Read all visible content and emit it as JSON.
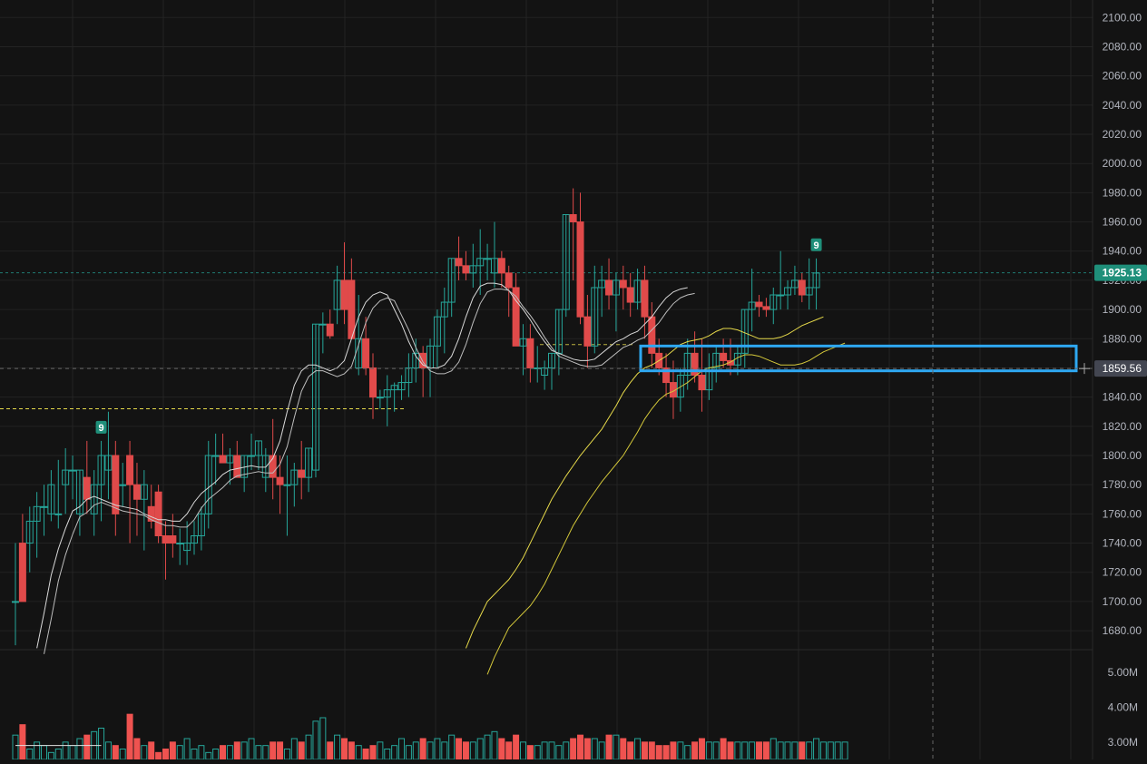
{
  "colors": {
    "background": "#131313",
    "grid": "#232323",
    "up": "#26a69a",
    "down": "#ef5350",
    "down_candle": "#e04a4a",
    "ma_fast": "#d9d9d9",
    "ma_slow": "#e6d94a",
    "highlight_box": "#2ea8f2",
    "current_price_bg": "#1f8f7a",
    "crosshair_price_bg": "#434651",
    "axis_text": "#b2b5be"
  },
  "price_axis": {
    "ticks": [
      "2100.00",
      "2080.00",
      "2060.00",
      "2040.00",
      "2020.00",
      "2000.00",
      "1980.00",
      "1960.00",
      "1940.00",
      "1920.00",
      "1900.00",
      "1880.00",
      "1860.00",
      "1840.00",
      "1820.00",
      "1800.00",
      "1780.00",
      "1760.00",
      "1740.00",
      "1720.00",
      "1700.00",
      "1680.00"
    ],
    "current_price_label": "1925.13",
    "crosshair_price_label": "1859.56"
  },
  "volume_axis": {
    "ticks": [
      "5.00M",
      "4.00M",
      "3.00M"
    ]
  },
  "markers": [
    {
      "label": "9",
      "candle_index": 12,
      "color": "up"
    },
    {
      "label": "9",
      "candle_index": 112,
      "color": "up"
    }
  ],
  "chart_data": {
    "type": "candlestick",
    "title": "",
    "ylim": [
      1667,
      2112
    ],
    "grid": true,
    "current_price": 1925.13,
    "crosshair_price": 1859.56,
    "support_level": 1832,
    "support_level_2": 1876,
    "highlight_zone": {
      "top": 1875,
      "bottom": 1858
    },
    "candles": [
      [
        1700,
        1740,
        1670,
        1700
      ],
      [
        1740,
        1760,
        1700,
        1700
      ],
      [
        1740,
        1765,
        1720,
        1755
      ],
      [
        1755,
        1775,
        1730,
        1765
      ],
      [
        1765,
        1780,
        1745,
        1765
      ],
      [
        1760,
        1790,
        1755,
        1780
      ],
      [
        1760,
        1797,
        1750,
        1760
      ],
      [
        1780,
        1805,
        1760,
        1790
      ],
      [
        1790,
        1800,
        1770,
        1790
      ],
      [
        1760,
        1790,
        1745,
        1790
      ],
      [
        1785,
        1810,
        1760,
        1770
      ],
      [
        1760,
        1790,
        1745,
        1780
      ],
      [
        1780,
        1810,
        1755,
        1800
      ],
      [
        1790,
        1830,
        1770,
        1800
      ],
      [
        1800,
        1810,
        1745,
        1760
      ],
      [
        1780,
        1795,
        1765,
        1780
      ],
      [
        1800,
        1810,
        1740,
        1780
      ],
      [
        1780,
        1795,
        1745,
        1770
      ],
      [
        1770,
        1790,
        1735,
        1780
      ],
      [
        1765,
        1780,
        1750,
        1755
      ],
      [
        1775,
        1780,
        1740,
        1745
      ],
      [
        1745,
        1755,
        1715,
        1740
      ],
      [
        1745,
        1760,
        1730,
        1740
      ],
      [
        1740,
        1750,
        1725,
        1740
      ],
      [
        1735,
        1755,
        1725,
        1740
      ],
      [
        1740,
        1755,
        1732,
        1745
      ],
      [
        1745,
        1765,
        1735,
        1760
      ],
      [
        1760,
        1810,
        1750,
        1800
      ],
      [
        1800,
        1815,
        1780,
        1800
      ],
      [
        1800,
        1815,
        1795,
        1795
      ],
      [
        1795,
        1805,
        1780,
        1800
      ],
      [
        1800,
        1810,
        1785,
        1785
      ],
      [
        1785,
        1800,
        1775,
        1800
      ],
      [
        1800,
        1815,
        1790,
        1800
      ],
      [
        1800,
        1810,
        1790,
        1810
      ],
      [
        1785,
        1805,
        1775,
        1800
      ],
      [
        1800,
        1825,
        1770,
        1785
      ],
      [
        1785,
        1800,
        1760,
        1780
      ],
      [
        1780,
        1800,
        1745,
        1780
      ],
      [
        1780,
        1795,
        1765,
        1790
      ],
      [
        1790,
        1810,
        1770,
        1785
      ],
      [
        1785,
        1805,
        1775,
        1805
      ],
      [
        1790,
        1890,
        1785,
        1890
      ],
      [
        1890,
        1898,
        1870,
        1890
      ],
      [
        1890,
        1900,
        1880,
        1882
      ],
      [
        1900,
        1930,
        1890,
        1920
      ],
      [
        1920,
        1946,
        1890,
        1900
      ],
      [
        1920,
        1935,
        1900,
        1880
      ],
      [
        1860,
        1910,
        1855,
        1880
      ],
      [
        1880,
        1895,
        1855,
        1860
      ],
      [
        1860,
        1870,
        1825,
        1840
      ],
      [
        1840,
        1845,
        1832,
        1840
      ],
      [
        1840,
        1855,
        1820,
        1845
      ],
      [
        1845,
        1850,
        1830,
        1848
      ],
      [
        1845,
        1855,
        1838,
        1850
      ],
      [
        1850,
        1870,
        1840,
        1860
      ],
      [
        1860,
        1880,
        1850,
        1870
      ],
      [
        1870,
        1875,
        1840,
        1860
      ],
      [
        1860,
        1880,
        1840,
        1875
      ],
      [
        1875,
        1900,
        1860,
        1895
      ],
      [
        1895,
        1915,
        1870,
        1905
      ],
      [
        1905,
        1935,
        1895,
        1935
      ],
      [
        1935,
        1950,
        1920,
        1930
      ],
      [
        1930,
        1940,
        1920,
        1925
      ],
      [
        1925,
        1945,
        1915,
        1930
      ],
      [
        1930,
        1955,
        1910,
        1935
      ],
      [
        1935,
        1945,
        1920,
        1935
      ],
      [
        1925,
        1960,
        1915,
        1935
      ],
      [
        1935,
        1940,
        1915,
        1925
      ],
      [
        1925,
        1930,
        1895,
        1915
      ],
      [
        1915,
        1925,
        1875,
        1875
      ],
      [
        1875,
        1890,
        1855,
        1880
      ],
      [
        1880,
        1890,
        1850,
        1860
      ],
      [
        1860,
        1875,
        1850,
        1860
      ],
      [
        1855,
        1865,
        1845,
        1860
      ],
      [
        1860,
        1870,
        1845,
        1870
      ],
      [
        1870,
        1900,
        1855,
        1900
      ],
      [
        1900,
        1965,
        1895,
        1965
      ],
      [
        1965,
        1983,
        1920,
        1960
      ],
      [
        1960,
        1980,
        1890,
        1895
      ],
      [
        1895,
        1910,
        1860,
        1875
      ],
      [
        1875,
        1930,
        1870,
        1915
      ],
      [
        1915,
        1930,
        1895,
        1920
      ],
      [
        1920,
        1935,
        1900,
        1910
      ],
      [
        1910,
        1925,
        1885,
        1920
      ],
      [
        1920,
        1930,
        1900,
        1915
      ],
      [
        1915,
        1925,
        1895,
        1905
      ],
      [
        1905,
        1928,
        1900,
        1920
      ],
      [
        1920,
        1930,
        1880,
        1895
      ],
      [
        1895,
        1905,
        1860,
        1870
      ],
      [
        1870,
        1880,
        1855,
        1860
      ],
      [
        1860,
        1870,
        1840,
        1850
      ],
      [
        1850,
        1865,
        1825,
        1840
      ],
      [
        1840,
        1860,
        1830,
        1855
      ],
      [
        1855,
        1880,
        1845,
        1870
      ],
      [
        1870,
        1885,
        1850,
        1855
      ],
      [
        1855,
        1880,
        1830,
        1845
      ],
      [
        1845,
        1870,
        1838,
        1860
      ],
      [
        1860,
        1875,
        1850,
        1870
      ],
      [
        1870,
        1880,
        1860,
        1865
      ],
      [
        1865,
        1880,
        1855,
        1862
      ],
      [
        1862,
        1875,
        1855,
        1870
      ],
      [
        1870,
        1900,
        1860,
        1900
      ],
      [
        1900,
        1928,
        1885,
        1905
      ],
      [
        1905,
        1910,
        1895,
        1902
      ],
      [
        1902,
        1908,
        1895,
        1900
      ],
      [
        1900,
        1915,
        1890,
        1910
      ],
      [
        1910,
        1940,
        1900,
        1910
      ],
      [
        1910,
        1920,
        1900,
        1915
      ],
      [
        1915,
        1930,
        1910,
        1920
      ],
      [
        1920,
        1925,
        1905,
        1910
      ],
      [
        1910,
        1935,
        1900,
        1915
      ],
      [
        1915,
        1935,
        1900,
        1925
      ]
    ],
    "ma_fast_1": [
      1668,
      1692,
      1718,
      1736,
      1750,
      1762,
      1765,
      1770,
      1772,
      1770,
      1768,
      1766,
      1765,
      1764,
      1763,
      1760,
      1758,
      1756,
      1756,
      1755,
      1755,
      1760,
      1768,
      1774,
      1778,
      1782,
      1787,
      1790,
      1791,
      1792,
      1793,
      1792,
      1792,
      1798,
      1810,
      1830,
      1848,
      1858,
      1862,
      1862,
      1860,
      1858,
      1860,
      1865,
      1880,
      1895,
      1905,
      1910,
      1912,
      1910,
      1900,
      1890,
      1878,
      1868,
      1862,
      1860,
      1860,
      1862,
      1868,
      1880,
      1895,
      1908,
      1916,
      1918,
      1918,
      1917,
      1913,
      1906,
      1900,
      1893,
      1885,
      1878,
      1872,
      1870,
      1868,
      1866,
      1865,
      1865,
      1866,
      1870,
      1874,
      1878,
      1880,
      1883,
      1885,
      1890,
      1895,
      1902,
      1908,
      1912,
      1914,
      1915
    ],
    "ma_slow_1": [
      1668,
      1680,
      1690,
      1700,
      1705,
      1710,
      1715,
      1722,
      1730,
      1740,
      1750,
      1760,
      1770,
      1778,
      1786,
      1793,
      1800,
      1806,
      1812,
      1818,
      1826,
      1834,
      1843,
      1850,
      1856,
      1860,
      1862,
      1865,
      1868,
      1872,
      1876,
      1878,
      1879,
      1880,
      1882,
      1885,
      1887,
      1887,
      1886,
      1884,
      1882,
      1880,
      1880,
      1880,
      1881,
      1883,
      1886,
      1889,
      1891,
      1893,
      1895
    ]
  },
  "volume": {
    "ylim": [
      2.5,
      5.5
    ],
    "bars": [
      3.2,
      3.5,
      2.8,
      3.0,
      2.9,
      2.7,
      2.8,
      3.0,
      2.9,
      3.1,
      3.2,
      3.3,
      3.4,
      3.0,
      2.9,
      2.8,
      3.8,
      3.1,
      2.9,
      3.0,
      2.7,
      2.8,
      3.0,
      2.9,
      3.1,
      2.8,
      2.9,
      2.7,
      2.8,
      2.9,
      2.9,
      3.0,
      3.0,
      3.1,
      2.9,
      2.9,
      3.0,
      3.0,
      2.8,
      3.1,
      3.0,
      3.2,
      3.6,
      3.7,
      3.0,
      3.2,
      3.1,
      3.0,
      2.9,
      2.8,
      2.9,
      3.0,
      2.8,
      2.9,
      3.1,
      2.9,
      3.0,
      3.1,
      3.0,
      3.1,
      3.0,
      3.2,
      3.1,
      3.0,
      3.0,
      3.1,
      3.2,
      3.3,
      3.1,
      3.0,
      3.2,
      3.0,
      2.9,
      2.9,
      3.0,
      3.0,
      2.9,
      3.0,
      3.1,
      3.2,
      3.1,
      3.1,
      3.0,
      3.2,
      3.2,
      3.1,
      3.0,
      3.1,
      3.0,
      3.0,
      2.9,
      2.9,
      3.0,
      3.0,
      2.9,
      3.0,
      3.1,
      3.0,
      3.0,
      3.1,
      3.0,
      3.0,
      3.0,
      3.0,
      3.0,
      3.0,
      3.1,
      3.0,
      3.0,
      3.0,
      3.0,
      3.0,
      3.1,
      3.0,
      3.0,
      3.0,
      3.0
    ],
    "ma_line": [
      2.9,
      2.9,
      2.9,
      2.9,
      2.9,
      2.9,
      2.9,
      2.9,
      2.9,
      2.9,
      2.9,
      2.9,
      2.9
    ]
  }
}
